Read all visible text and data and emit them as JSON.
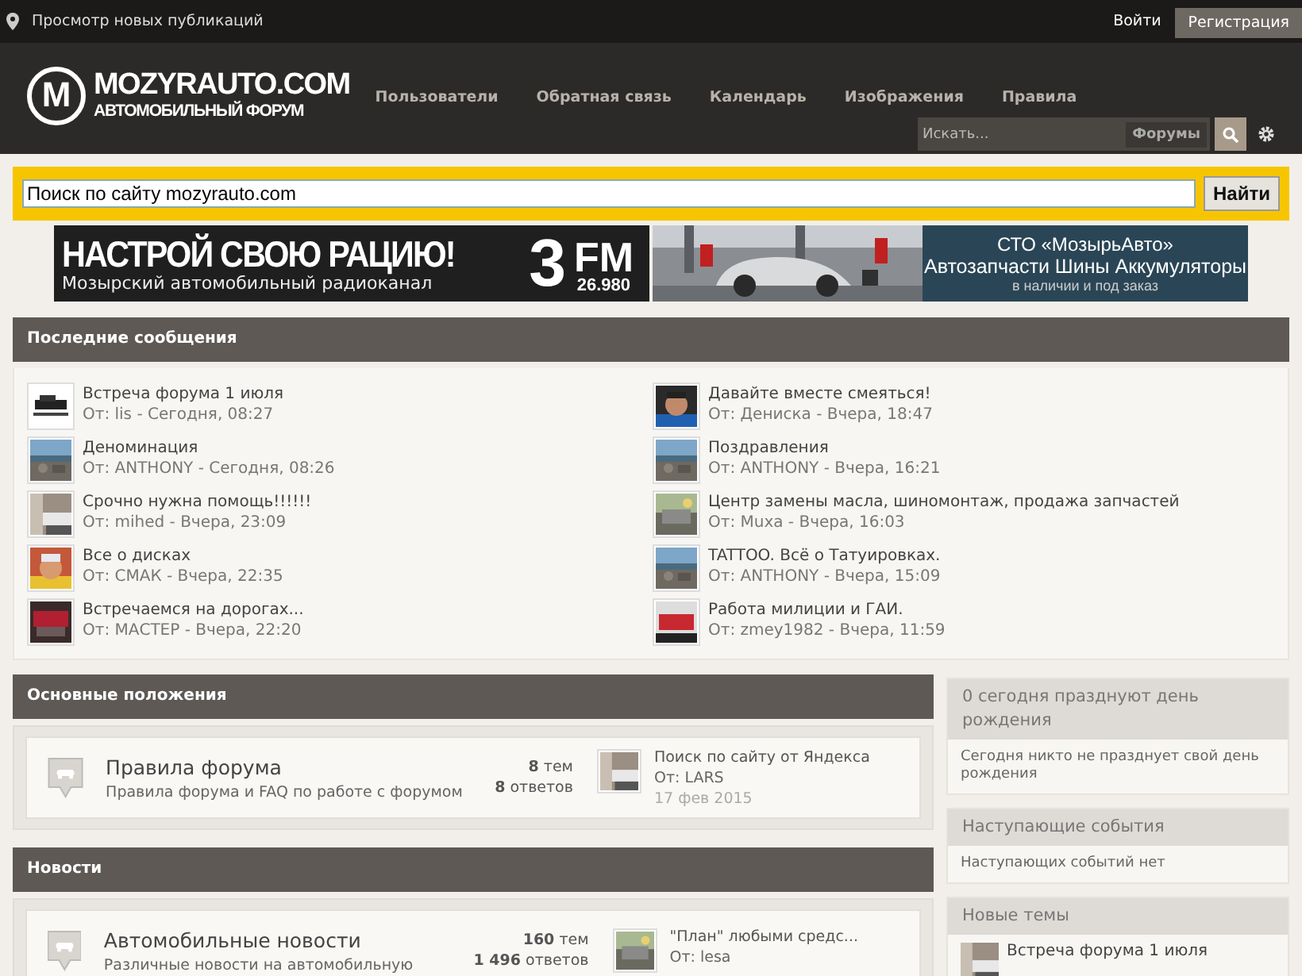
{
  "top_bar": {
    "new_posts_link": "Просмотр новых публикаций",
    "login": "Войти",
    "register": "Регистрация"
  },
  "logo": {
    "letter": "M",
    "title": "MOZYRAUTO.COM",
    "subtitle": "АВТОМОБИЛЬНЫЙ ФОРУМ"
  },
  "nav": [
    "Пользователи",
    "Обратная связь",
    "Календарь",
    "Изображения",
    "Правила"
  ],
  "header_search": {
    "placeholder": "Искать...",
    "scope": "Форумы"
  },
  "site_search": {
    "value": "Поиск по сайту mozyrauto.com",
    "button": "Найти"
  },
  "banners": [
    {
      "kind": "radio",
      "headline": "НАСТРОЙ СВОЮ РАЦИЮ!",
      "caption": "Мозырский автомобильный радиоканал",
      "logo_number": "3",
      "logo_text": "FM",
      "frequency": "26.980"
    },
    {
      "kind": "shop",
      "title": "СТО «МозырьАвто»",
      "line": "Автозапчасти Шины Аккумуляторы",
      "note": "в наличии и под заказ"
    }
  ],
  "recent_posts": {
    "title": "Последние сообщения",
    "posts": [
      {
        "title": "Встреча форума 1 июля",
        "meta": "От: lis - Сегодня, 08:27"
      },
      {
        "title": "Деноминация",
        "meta": "От: ANTHONY - Сегодня, 08:26"
      },
      {
        "title": "Срочно нужна помощь!!!!!!",
        "meta": "От: mihed - Вчера, 23:09"
      },
      {
        "title": "Все о дисках",
        "meta": "От: СМАК - Вчера, 22:35"
      },
      {
        "title": "Встречаемся на дорогах...",
        "meta": "От: МАСТЕР - Вчера, 22:20"
      },
      {
        "title": "Давайте вместе смеяться!",
        "meta": "От: Дениска - Вчера, 18:47"
      },
      {
        "title": "Поздравления",
        "meta": "От: ANTHONY - Вчера, 16:21"
      },
      {
        "title": "Центр замены масла, шиномонтаж, продажа запчастей",
        "meta": "От: Muxa - Вчера, 16:03"
      },
      {
        "title": "TATTOO. Всё о Татуировках.",
        "meta": "От: ANTHONY - Вчера, 15:09"
      },
      {
        "title": "Работа милиции и ГАИ.",
        "meta": "От: zmey1982 - Вчера, 11:59"
      }
    ]
  },
  "categories": [
    {
      "title": "Основные положения",
      "forums": [
        {
          "name": "Правила форума",
          "description": "Правила форума и FAQ по работе с форумом",
          "topics": "**8** тем",
          "replies": "**8** ответов",
          "last_post": {
            "title": "Поиск по сайту от Яндекса",
            "author": "От: LARS",
            "date": "17 фев 2015"
          }
        }
      ]
    },
    {
      "title": "Новости",
      "forums": [
        {
          "name": "Автомобильные новости",
          "description": "Различные новости на автомобильную",
          "topics": "**160** тем",
          "replies": "**1 496** ответов",
          "last_post": {
            "title": "\"План\" любыми средс...",
            "author": "От: lesa"
          }
        }
      ]
    }
  ],
  "sidebar": [
    {
      "title": "0 сегодня празднуют день рождения",
      "text": "Сегодня никто не празднует свой день рождения"
    },
    {
      "title": "Наступающие события",
      "text": "Наступающих событий нет"
    },
    {
      "title": "Новые темы",
      "topics": [
        "Встреча форума 1 июля"
      ]
    }
  ]
}
